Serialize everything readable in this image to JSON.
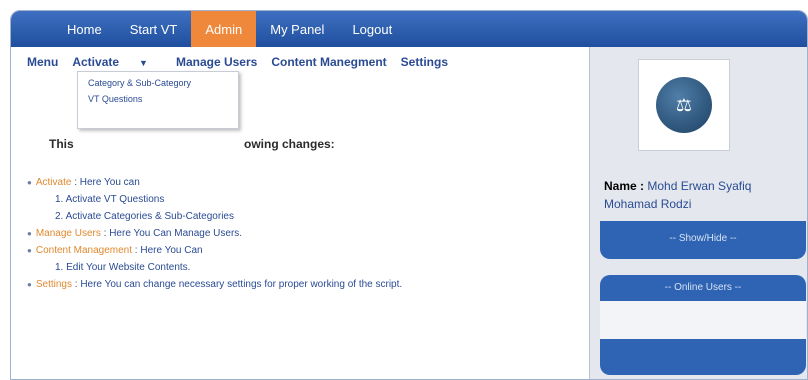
{
  "nav": {
    "items": [
      "Home",
      "Start VT",
      "Admin",
      "My Panel",
      "Logout"
    ]
  },
  "submenu": {
    "menu": "Menu",
    "activate": "Activate",
    "manage_users": "Manage Users",
    "content": "Content Manegment",
    "settings": "Settings"
  },
  "dropdown": {
    "items": [
      "Category & Sub-Category",
      "VT Questions"
    ]
  },
  "welcome": {
    "prefix": "This",
    "suffix": "owing changes:"
  },
  "content": {
    "activate_label": "Activate",
    "activate_text": " : Here You can",
    "activate_sub1": "1. Activate VT Questions",
    "activate_sub2": "2. Activate Categories & Sub-Categories",
    "manage_label": "Manage Users",
    "manage_text": " : Here You Can Manage Users.",
    "content_label": "Content Management",
    "content_text": " : Here You Can",
    "content_sub1": "1. Edit Your Website Contents.",
    "settings_label": "Settings",
    "settings_text": " : Here You can change necessary settings for proper working of the script."
  },
  "sidebar": {
    "name_label": "Name :",
    "name_line1": "Mohd Erwan Syafiq",
    "name_line2": "Mohamad Rodzi",
    "show_hide": "-- Show/Hide --",
    "online_users": "-- Online Users --"
  },
  "colors": {
    "nav_blue": "#1f4f9e",
    "active_orange": "#f0883c",
    "link_blue": "#2a4b93",
    "highlight_orange": "#e0892f"
  }
}
